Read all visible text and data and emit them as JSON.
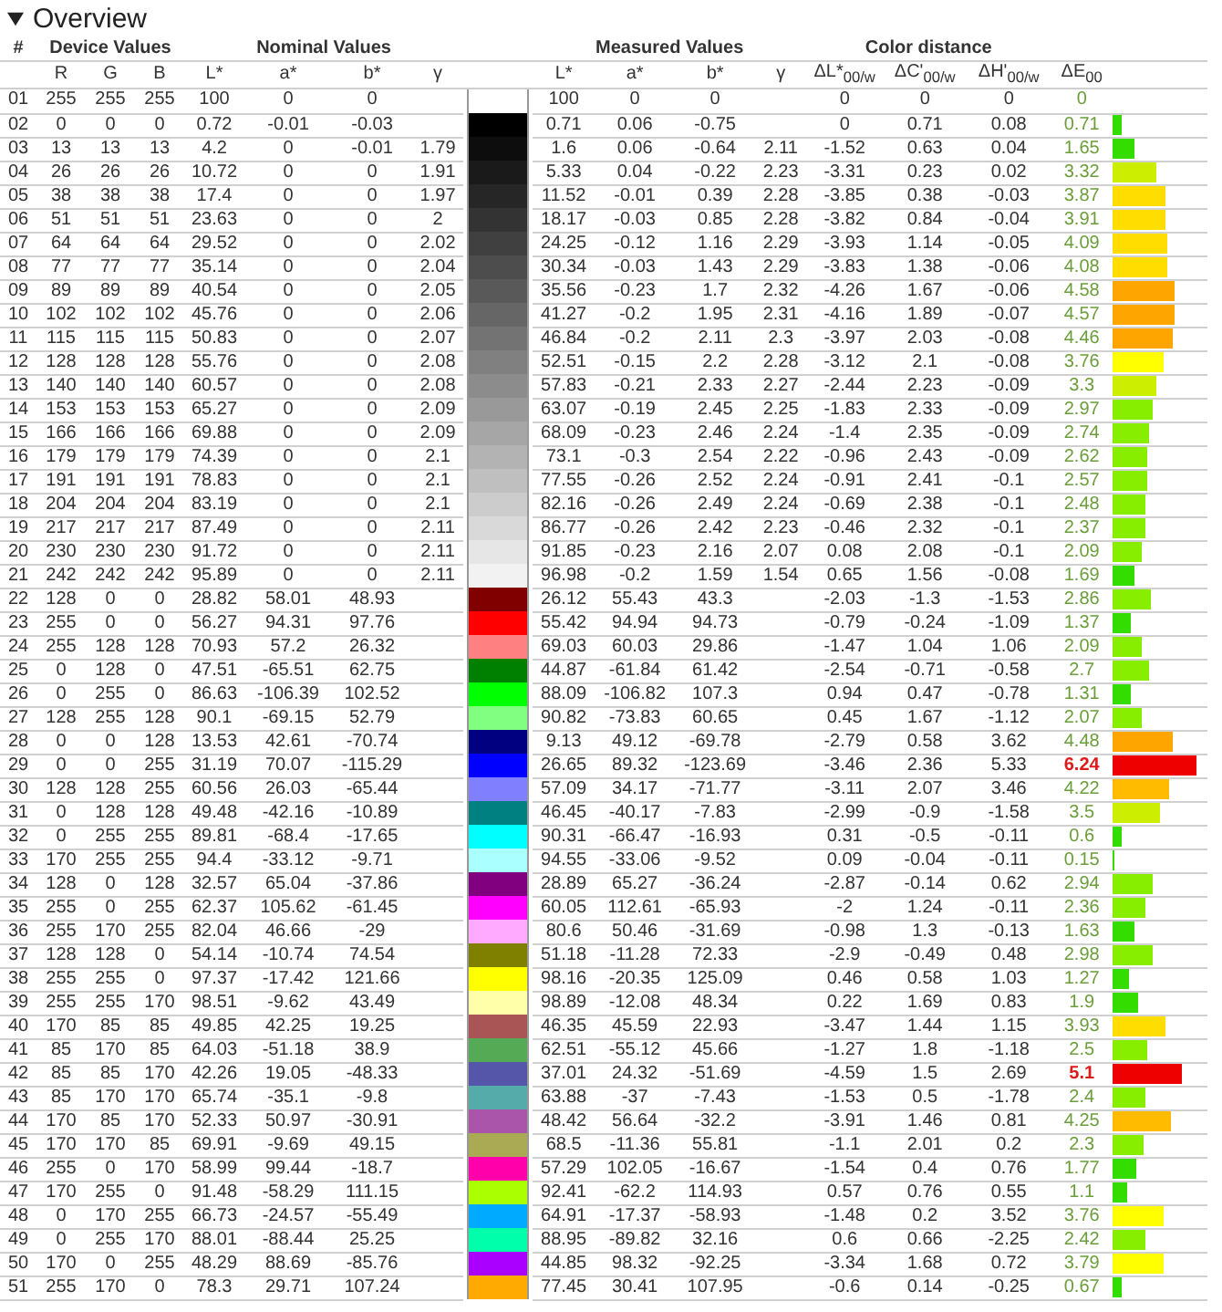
{
  "section": {
    "title": "Overview",
    "expanded": true
  },
  "group_headers": [
    "#",
    "Device Values",
    "Nominal Values",
    "Measured Values",
    "Color distance"
  ],
  "columns": [
    "R",
    "G",
    "B",
    "L*",
    "a*",
    "b*",
    "γ",
    "L*",
    "a*",
    "b*",
    "γ",
    "ΔL*$_{00/w}$",
    "ΔC'$_{00/w}$",
    "ΔH'$_{00/w}$",
    "ΔE$_{00}$"
  ],
  "rows": [
    {
      "no": "01",
      "device": [
        "255",
        "255",
        "255"
      ],
      "nominal": [
        "100",
        "0",
        "0"
      ],
      "measured": [
        "100",
        "0",
        "0"
      ],
      "distance": [
        "0",
        "0",
        "0",
        "0"
      ],
      "exceeds": false
    },
    {
      "no": "02",
      "device": [
        "0",
        "0",
        "0"
      ],
      "nominal": [
        "0.72",
        "-0.01",
        "-0.03"
      ],
      "measured": [
        "0.71",
        "0.06",
        "-0.75"
      ],
      "distance": [
        "0",
        "0.71",
        "0.08",
        "0.71"
      ],
      "level": 0.1,
      "color": "#33dd00",
      "exceeds": false
    },
    {
      "no": "03",
      "device": [
        "13",
        "13",
        "13"
      ],
      "nominal": [
        "4.2",
        "0",
        "-0.01",
        "1.79"
      ],
      "measured": [
        "1.6",
        "0.06",
        "-0.64",
        "2.11"
      ],
      "distance": [
        "-1.52",
        "0.63",
        "0.04",
        "1.65"
      ],
      "level": 0.24,
      "color": "#33dd00",
      "exceeds": false
    },
    {
      "no": "04",
      "device": [
        "26",
        "26",
        "26"
      ],
      "nominal": [
        "10.72",
        "0",
        "0",
        "1.91"
      ],
      "measured": [
        "5.33",
        "0.04",
        "-0.22",
        "2.23"
      ],
      "distance": [
        "-3.31",
        "0.23",
        "0.02",
        "3.32"
      ],
      "level": 0.47,
      "color": "#ccee00",
      "exceeds": false
    },
    {
      "no": "05",
      "device": [
        "38",
        "38",
        "38"
      ],
      "nominal": [
        "17.4",
        "0",
        "0",
        "1.97"
      ],
      "measured": [
        "11.52",
        "-0.01",
        "0.39",
        "2.28"
      ],
      "distance": [
        "-3.85",
        "0.38",
        "-0.03",
        "3.87"
      ],
      "level": 0.55,
      "color": "#ffdd00",
      "exceeds": false
    },
    {
      "no": "06",
      "device": [
        "51",
        "51",
        "51"
      ],
      "nominal": [
        "23.63",
        "0",
        "0",
        "2"
      ],
      "measured": [
        "18.17",
        "-0.03",
        "0.85",
        "2.28"
      ],
      "distance": [
        "-3.82",
        "0.84",
        "-0.04",
        "3.91"
      ],
      "level": 0.56,
      "color": "#ffdd00",
      "exceeds": false
    },
    {
      "no": "07",
      "device": [
        "64",
        "64",
        "64"
      ],
      "nominal": [
        "29.52",
        "0",
        "0",
        "2.02"
      ],
      "measured": [
        "24.25",
        "-0.12",
        "1.16",
        "2.29"
      ],
      "distance": [
        "-3.93",
        "1.14",
        "-0.05",
        "4.09"
      ],
      "level": 0.58,
      "color": "#ffdd00",
      "exceeds": false
    },
    {
      "no": "08",
      "device": [
        "77",
        "77",
        "77"
      ],
      "nominal": [
        "35.14",
        "0",
        "0",
        "2.04"
      ],
      "measured": [
        "30.34",
        "-0.03",
        "1.43",
        "2.29"
      ],
      "distance": [
        "-3.83",
        "1.38",
        "-0.06",
        "4.08"
      ],
      "level": 0.58,
      "color": "#ffdd00",
      "exceeds": false
    },
    {
      "no": "09",
      "device": [
        "89",
        "89",
        "89"
      ],
      "nominal": [
        "40.54",
        "0",
        "0",
        "2.05"
      ],
      "measured": [
        "35.56",
        "-0.23",
        "1.7",
        "2.32"
      ],
      "distance": [
        "-4.26",
        "1.67",
        "-0.06",
        "4.58"
      ],
      "level": 0.65,
      "color": "#ffa500",
      "exceeds": false
    },
    {
      "no": "10",
      "device": [
        "102",
        "102",
        "102"
      ],
      "nominal": [
        "45.76",
        "0",
        "0",
        "2.06"
      ],
      "measured": [
        "41.27",
        "-0.2",
        "1.95",
        "2.31"
      ],
      "distance": [
        "-4.16",
        "1.89",
        "-0.07",
        "4.57"
      ],
      "level": 0.65,
      "color": "#ffa500",
      "exceeds": false
    },
    {
      "no": "11",
      "device": [
        "115",
        "115",
        "115"
      ],
      "nominal": [
        "50.83",
        "0",
        "0",
        "2.07"
      ],
      "measured": [
        "46.84",
        "-0.2",
        "2.11",
        "2.3"
      ],
      "distance": [
        "-3.97",
        "2.03",
        "-0.08",
        "4.46"
      ],
      "level": 0.64,
      "color": "#ffa500",
      "exceeds": false
    },
    {
      "no": "12",
      "device": [
        "128",
        "128",
        "128"
      ],
      "nominal": [
        "55.76",
        "0",
        "0",
        "2.08"
      ],
      "measured": [
        "52.51",
        "-0.15",
        "2.2",
        "2.28"
      ],
      "distance": [
        "-3.12",
        "2.1",
        "-0.08",
        "3.76"
      ],
      "level": 0.54,
      "color": "#ffff00",
      "exceeds": false
    },
    {
      "no": "13",
      "device": [
        "140",
        "140",
        "140"
      ],
      "nominal": [
        "60.57",
        "0",
        "0",
        "2.08"
      ],
      "measured": [
        "57.83",
        "-0.21",
        "2.33",
        "2.27"
      ],
      "distance": [
        "-2.44",
        "2.23",
        "-0.09",
        "3.3"
      ],
      "level": 0.47,
      "color": "#ccee00",
      "exceeds": false
    },
    {
      "no": "14",
      "device": [
        "153",
        "153",
        "153"
      ],
      "nominal": [
        "65.27",
        "0",
        "0",
        "2.09"
      ],
      "measured": [
        "63.07",
        "-0.19",
        "2.45",
        "2.25"
      ],
      "distance": [
        "-1.83",
        "2.33",
        "-0.09",
        "2.97"
      ],
      "level": 0.42,
      "color": "#88ee00",
      "exceeds": false
    },
    {
      "no": "15",
      "device": [
        "166",
        "166",
        "166"
      ],
      "nominal": [
        "69.88",
        "0",
        "0",
        "2.09"
      ],
      "measured": [
        "68.09",
        "-0.23",
        "2.46",
        "2.24"
      ],
      "distance": [
        "-1.4",
        "2.35",
        "-0.09",
        "2.74"
      ],
      "level": 0.39,
      "color": "#88ee00",
      "exceeds": false
    },
    {
      "no": "16",
      "device": [
        "179",
        "179",
        "179"
      ],
      "nominal": [
        "74.39",
        "0",
        "0",
        "2.1"
      ],
      "measured": [
        "73.1",
        "-0.3",
        "2.54",
        "2.22"
      ],
      "distance": [
        "-0.96",
        "2.43",
        "-0.09",
        "2.62"
      ],
      "level": 0.37,
      "color": "#88ee00",
      "exceeds": false
    },
    {
      "no": "17",
      "device": [
        "191",
        "191",
        "191"
      ],
      "nominal": [
        "78.83",
        "0",
        "0",
        "2.1"
      ],
      "measured": [
        "77.55",
        "-0.26",
        "2.52",
        "2.24"
      ],
      "distance": [
        "-0.91",
        "2.41",
        "-0.1",
        "2.57"
      ],
      "level": 0.37,
      "color": "#88ee00",
      "exceeds": false
    },
    {
      "no": "18",
      "device": [
        "204",
        "204",
        "204"
      ],
      "nominal": [
        "83.19",
        "0",
        "0",
        "2.1"
      ],
      "measured": [
        "82.16",
        "-0.26",
        "2.49",
        "2.24"
      ],
      "distance": [
        "-0.69",
        "2.38",
        "-0.1",
        "2.48"
      ],
      "level": 0.35,
      "color": "#88ee00",
      "exceeds": false
    },
    {
      "no": "19",
      "device": [
        "217",
        "217",
        "217"
      ],
      "nominal": [
        "87.49",
        "0",
        "0",
        "2.11"
      ],
      "measured": [
        "86.77",
        "-0.26",
        "2.42",
        "2.23"
      ],
      "distance": [
        "-0.46",
        "2.32",
        "-0.1",
        "2.37"
      ],
      "level": 0.34,
      "color": "#88ee00",
      "exceeds": false
    },
    {
      "no": "20",
      "device": [
        "230",
        "230",
        "230"
      ],
      "nominal": [
        "91.72",
        "0",
        "0",
        "2.11"
      ],
      "measured": [
        "91.85",
        "-0.23",
        "2.16",
        "2.07"
      ],
      "distance": [
        "0.08",
        "2.08",
        "-0.1",
        "2.09"
      ],
      "level": 0.3,
      "color": "#88ee00",
      "exceeds": false
    },
    {
      "no": "21",
      "device": [
        "242",
        "242",
        "242"
      ],
      "nominal": [
        "95.89",
        "0",
        "0",
        "2.11"
      ],
      "measured": [
        "96.98",
        "-0.2",
        "1.59",
        "1.54"
      ],
      "distance": [
        "0.65",
        "1.56",
        "-0.08",
        "1.69"
      ],
      "level": 0.24,
      "color": "#33dd00",
      "exceeds": false
    },
    {
      "no": "22",
      "device": [
        "128",
        "0",
        "0"
      ],
      "nominal": [
        "28.82",
        "58.01",
        "48.93"
      ],
      "measured": [
        "26.12",
        "55.43",
        "43.3"
      ],
      "distance": [
        "-2.03",
        "-1.3",
        "-1.53",
        "2.86"
      ],
      "level": 0.41,
      "color": "#88ee00",
      "exceeds": false
    },
    {
      "no": "23",
      "device": [
        "255",
        "0",
        "0"
      ],
      "nominal": [
        "56.27",
        "94.31",
        "97.76"
      ],
      "measured": [
        "55.42",
        "94.94",
        "94.73"
      ],
      "distance": [
        "-0.79",
        "-0.24",
        "-1.09",
        "1.37"
      ],
      "level": 0.2,
      "color": "#33dd00",
      "exceeds": false
    },
    {
      "no": "24",
      "device": [
        "255",
        "128",
        "128"
      ],
      "nominal": [
        "70.93",
        "57.2",
        "26.32"
      ],
      "measured": [
        "69.03",
        "60.03",
        "29.86"
      ],
      "distance": [
        "-1.47",
        "1.04",
        "1.06",
        "2.09"
      ],
      "level": 0.3,
      "color": "#88ee00",
      "exceeds": false
    },
    {
      "no": "25",
      "device": [
        "0",
        "128",
        "0"
      ],
      "nominal": [
        "47.51",
        "-65.51",
        "62.75"
      ],
      "measured": [
        "44.87",
        "-61.84",
        "61.42"
      ],
      "distance": [
        "-2.54",
        "-0.71",
        "-0.58",
        "2.7"
      ],
      "level": 0.39,
      "color": "#88ee00",
      "exceeds": false
    },
    {
      "no": "26",
      "device": [
        "0",
        "255",
        "0"
      ],
      "nominal": [
        "86.63",
        "-106.39",
        "102.52"
      ],
      "measured": [
        "88.09",
        "-106.82",
        "107.3"
      ],
      "distance": [
        "0.94",
        "0.47",
        "-0.78",
        "1.31"
      ],
      "level": 0.19,
      "color": "#33dd00",
      "exceeds": false
    },
    {
      "no": "27",
      "device": [
        "128",
        "255",
        "128"
      ],
      "nominal": [
        "90.1",
        "-69.15",
        "52.79"
      ],
      "measured": [
        "90.82",
        "-73.83",
        "60.65"
      ],
      "distance": [
        "0.45",
        "1.67",
        "-1.12",
        "2.07"
      ],
      "level": 0.3,
      "color": "#88ee00",
      "exceeds": false
    },
    {
      "no": "28",
      "device": [
        "0",
        "0",
        "128"
      ],
      "nominal": [
        "13.53",
        "42.61",
        "-70.74"
      ],
      "measured": [
        "9.13",
        "49.12",
        "-69.78"
      ],
      "distance": [
        "-2.79",
        "0.58",
        "3.62",
        "4.48"
      ],
      "level": 0.64,
      "color": "#ffa500",
      "exceeds": false
    },
    {
      "no": "29",
      "device": [
        "0",
        "0",
        "255"
      ],
      "nominal": [
        "31.19",
        "70.07",
        "-115.29"
      ],
      "measured": [
        "26.65",
        "89.32",
        "-123.69"
      ],
      "distance": [
        "-3.46",
        "2.36",
        "5.33",
        "6.24"
      ],
      "level": 0.89,
      "color": "#ee0000",
      "exceeds": true
    },
    {
      "no": "30",
      "device": [
        "128",
        "128",
        "255"
      ],
      "nominal": [
        "60.56",
        "26.03",
        "-65.44"
      ],
      "measured": [
        "57.09",
        "34.17",
        "-71.77"
      ],
      "distance": [
        "-3.11",
        "2.07",
        "3.46",
        "4.22"
      ],
      "level": 0.6,
      "color": "#ffbb00",
      "exceeds": false
    },
    {
      "no": "31",
      "device": [
        "0",
        "128",
        "128"
      ],
      "nominal": [
        "49.48",
        "-42.16",
        "-10.89"
      ],
      "measured": [
        "46.45",
        "-40.17",
        "-7.83"
      ],
      "distance": [
        "-2.99",
        "-0.9",
        "-1.58",
        "3.5"
      ],
      "level": 0.5,
      "color": "#ccee00",
      "exceeds": false
    },
    {
      "no": "32",
      "device": [
        "0",
        "255",
        "255"
      ],
      "nominal": [
        "89.81",
        "-68.4",
        "-17.65"
      ],
      "measured": [
        "90.31",
        "-66.47",
        "-16.93"
      ],
      "distance": [
        "0.31",
        "-0.5",
        "-0.11",
        "0.6"
      ],
      "level": 0.09,
      "color": "#33dd00",
      "exceeds": false
    },
    {
      "no": "33",
      "device": [
        "170",
        "255",
        "255"
      ],
      "nominal": [
        "94.4",
        "-33.12",
        "-9.71"
      ],
      "measured": [
        "94.55",
        "-33.06",
        "-9.52"
      ],
      "distance": [
        "0.09",
        "-0.04",
        "-0.11",
        "0.15"
      ],
      "level": 0.02,
      "color": "#33dd00",
      "exceeds": false
    },
    {
      "no": "34",
      "device": [
        "128",
        "0",
        "128"
      ],
      "nominal": [
        "32.57",
        "65.04",
        "-37.86"
      ],
      "measured": [
        "28.89",
        "65.27",
        "-36.24"
      ],
      "distance": [
        "-2.87",
        "-0.14",
        "0.62",
        "2.94"
      ],
      "level": 0.42,
      "color": "#88ee00",
      "exceeds": false
    },
    {
      "no": "35",
      "device": [
        "255",
        "0",
        "255"
      ],
      "nominal": [
        "62.37",
        "105.62",
        "-61.45"
      ],
      "measured": [
        "60.05",
        "112.61",
        "-65.93"
      ],
      "distance": [
        "-2",
        "1.24",
        "-0.11",
        "2.36"
      ],
      "level": 0.34,
      "color": "#88ee00",
      "exceeds": false
    },
    {
      "no": "36",
      "device": [
        "255",
        "170",
        "255"
      ],
      "nominal": [
        "82.04",
        "46.66",
        "-29"
      ],
      "measured": [
        "80.6",
        "50.46",
        "-31.69"
      ],
      "distance": [
        "-0.98",
        "1.3",
        "-0.13",
        "1.63"
      ],
      "level": 0.23,
      "color": "#33dd00",
      "exceeds": false
    },
    {
      "no": "37",
      "device": [
        "128",
        "128",
        "0"
      ],
      "nominal": [
        "54.14",
        "-10.74",
        "74.54"
      ],
      "measured": [
        "51.18",
        "-11.28",
        "72.33"
      ],
      "distance": [
        "-2.9",
        "-0.49",
        "0.48",
        "2.98"
      ],
      "level": 0.43,
      "color": "#88ee00",
      "exceeds": false
    },
    {
      "no": "38",
      "device": [
        "255",
        "255",
        "0"
      ],
      "nominal": [
        "97.37",
        "-17.42",
        "121.66"
      ],
      "measured": [
        "98.16",
        "-20.35",
        "125.09"
      ],
      "distance": [
        "0.46",
        "0.58",
        "1.03",
        "1.27"
      ],
      "level": 0.18,
      "color": "#33dd00",
      "exceeds": false
    },
    {
      "no": "39",
      "device": [
        "255",
        "255",
        "170"
      ],
      "nominal": [
        "98.51",
        "-9.62",
        "43.49"
      ],
      "measured": [
        "98.89",
        "-12.08",
        "48.34"
      ],
      "distance": [
        "0.22",
        "1.69",
        "0.83",
        "1.9"
      ],
      "level": 0.27,
      "color": "#33dd00",
      "exceeds": false
    },
    {
      "no": "40",
      "device": [
        "170",
        "85",
        "85"
      ],
      "nominal": [
        "49.85",
        "42.25",
        "19.25"
      ],
      "measured": [
        "46.35",
        "45.59",
        "22.93"
      ],
      "distance": [
        "-3.47",
        "1.44",
        "1.15",
        "3.93"
      ],
      "level": 0.56,
      "color": "#ffdd00",
      "exceeds": false
    },
    {
      "no": "41",
      "device": [
        "85",
        "170",
        "85"
      ],
      "nominal": [
        "64.03",
        "-51.18",
        "38.9"
      ],
      "measured": [
        "62.51",
        "-55.12",
        "45.66"
      ],
      "distance": [
        "-1.27",
        "1.8",
        "-1.18",
        "2.5"
      ],
      "level": 0.36,
      "color": "#88ee00",
      "exceeds": false
    },
    {
      "no": "42",
      "device": [
        "85",
        "85",
        "170"
      ],
      "nominal": [
        "42.26",
        "19.05",
        "-48.33"
      ],
      "measured": [
        "37.01",
        "24.32",
        "-51.69"
      ],
      "distance": [
        "-4.59",
        "1.5",
        "2.69",
        "5.1"
      ],
      "level": 0.73,
      "color": "#ee0000",
      "exceeds": true
    },
    {
      "no": "43",
      "device": [
        "85",
        "170",
        "170"
      ],
      "nominal": [
        "65.74",
        "-35.1",
        "-9.8"
      ],
      "measured": [
        "63.88",
        "-37",
        "-7.43"
      ],
      "distance": [
        "-1.53",
        "0.5",
        "-1.78",
        "2.4"
      ],
      "level": 0.34,
      "color": "#88ee00",
      "exceeds": false
    },
    {
      "no": "44",
      "device": [
        "170",
        "85",
        "170"
      ],
      "nominal": [
        "52.33",
        "50.97",
        "-30.91"
      ],
      "measured": [
        "48.42",
        "56.64",
        "-32.2"
      ],
      "distance": [
        "-3.91",
        "1.46",
        "0.81",
        "4.25"
      ],
      "level": 0.61,
      "color": "#ffbb00",
      "exceeds": false
    },
    {
      "no": "45",
      "device": [
        "170",
        "170",
        "85"
      ],
      "nominal": [
        "69.91",
        "-9.69",
        "49.15"
      ],
      "measured": [
        "68.5",
        "-11.36",
        "55.81"
      ],
      "distance": [
        "-1.1",
        "2.01",
        "0.2",
        "2.3"
      ],
      "level": 0.33,
      "color": "#88ee00",
      "exceeds": false
    },
    {
      "no": "46",
      "device": [
        "255",
        "0",
        "170"
      ],
      "nominal": [
        "58.99",
        "99.44",
        "-18.7"
      ],
      "measured": [
        "57.29",
        "102.05",
        "-16.67"
      ],
      "distance": [
        "-1.54",
        "0.4",
        "0.76",
        "1.77"
      ],
      "level": 0.25,
      "color": "#33dd00",
      "exceeds": false
    },
    {
      "no": "47",
      "device": [
        "170",
        "255",
        "0"
      ],
      "nominal": [
        "91.48",
        "-58.29",
        "111.15"
      ],
      "measured": [
        "92.41",
        "-62.2",
        "114.93"
      ],
      "distance": [
        "0.57",
        "0.76",
        "0.55",
        "1.1"
      ],
      "level": 0.16,
      "color": "#33dd00",
      "exceeds": false
    },
    {
      "no": "48",
      "device": [
        "0",
        "170",
        "255"
      ],
      "nominal": [
        "66.73",
        "-24.57",
        "-55.49"
      ],
      "measured": [
        "64.91",
        "-17.37",
        "-58.93"
      ],
      "distance": [
        "-1.48",
        "0.2",
        "3.52",
        "3.76"
      ],
      "level": 0.54,
      "color": "#ffff00",
      "exceeds": false
    },
    {
      "no": "49",
      "device": [
        "0",
        "255",
        "170"
      ],
      "nominal": [
        "88.01",
        "-88.44",
        "25.25"
      ],
      "measured": [
        "88.95",
        "-89.82",
        "32.16"
      ],
      "distance": [
        "0.6",
        "0.66",
        "-2.25",
        "2.42"
      ],
      "level": 0.35,
      "color": "#88ee00",
      "exceeds": false
    },
    {
      "no": "50",
      "device": [
        "170",
        "0",
        "255"
      ],
      "nominal": [
        "48.29",
        "88.69",
        "-85.76"
      ],
      "measured": [
        "44.85",
        "98.32",
        "-92.25"
      ],
      "distance": [
        "-3.34",
        "1.68",
        "0.72",
        "3.79"
      ],
      "level": 0.54,
      "color": "#ffff00",
      "exceeds": false
    },
    {
      "no": "51",
      "device": [
        "255",
        "170",
        "0"
      ],
      "nominal": [
        "78.3",
        "29.71",
        "107.24"
      ],
      "measured": [
        "77.45",
        "30.41",
        "107.95"
      ],
      "distance": [
        "-0.6",
        "0.14",
        "-0.25",
        "0.67"
      ],
      "level": 0.1,
      "color": "#33dd00",
      "exceeds": false
    }
  ]
}
